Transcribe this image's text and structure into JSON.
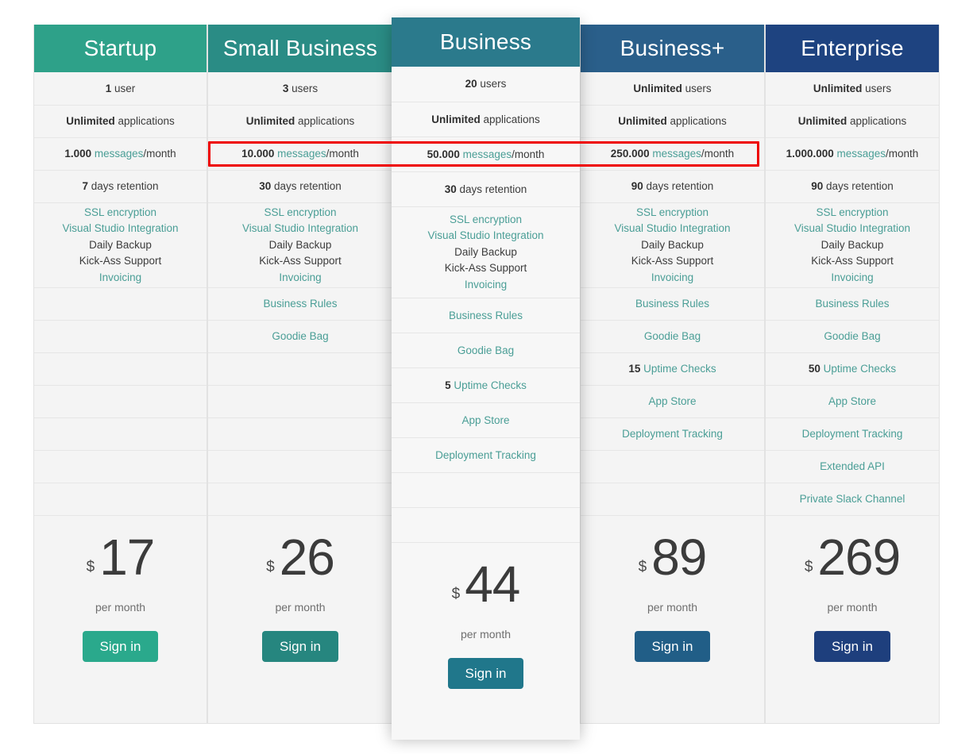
{
  "table": {
    "currency_symbol": "$",
    "per_month_label": "per month",
    "signin_label": "Sign in",
    "colors": {
      "startup_header": "#2ea189",
      "small_business_header": "#2a8c85",
      "business_header": "#2b7a8c",
      "business_plus_header": "#2a5f8a",
      "enterprise_header": "#1e4380",
      "startup_button": "#2aa98c",
      "small_business_button": "#26867f",
      "business_button": "#20778b",
      "business_plus_button": "#215e87",
      "enterprise_button": "#1e3f7d",
      "link_teal": "#4a9e96",
      "text_dark": "#3c3c3c",
      "cell_background": "#f4f4f4",
      "featured_background": "#f7f7f7",
      "highlight_red": "#ee0000"
    }
  },
  "plans": [
    {
      "id": "startup",
      "name": "Startup",
      "users_count": "1",
      "users_label": "user",
      "apps_count": "Unlimited",
      "apps_label": "applications",
      "messages_count": "1.000",
      "messages_word": "messages",
      "messages_suffix": "/month",
      "retention_count": "7",
      "retention_label": "days retention",
      "features": [
        {
          "text": "SSL encryption",
          "style": "teal"
        },
        {
          "text": "Visual Studio Integration",
          "style": "teal"
        },
        {
          "text": "Daily Backup",
          "style": "dark"
        },
        {
          "text": "Kick-Ass Support",
          "style": "dark"
        },
        {
          "text": "Invoicing",
          "style": "teal"
        }
      ],
      "business_rules": "",
      "goodie_bag": "",
      "uptime_count": "",
      "uptime_label": "",
      "app_store": "",
      "deployment_tracking": "",
      "extended_api": "",
      "private_slack": "",
      "price": "17"
    },
    {
      "id": "small-business",
      "name": "Small Business",
      "users_count": "3",
      "users_label": "users",
      "apps_count": "Unlimited",
      "apps_label": "applications",
      "messages_count": "10.000",
      "messages_word": "messages",
      "messages_suffix": "/month",
      "retention_count": "30",
      "retention_label": "days retention",
      "features": [
        {
          "text": "SSL encryption",
          "style": "teal"
        },
        {
          "text": "Visual Studio Integration",
          "style": "teal"
        },
        {
          "text": "Daily Backup",
          "style": "dark"
        },
        {
          "text": "Kick-Ass Support",
          "style": "dark"
        },
        {
          "text": "Invoicing",
          "style": "teal"
        }
      ],
      "business_rules": "Business Rules",
      "goodie_bag": "Goodie Bag",
      "uptime_count": "",
      "uptime_label": "",
      "app_store": "",
      "deployment_tracking": "",
      "extended_api": "",
      "private_slack": "",
      "price": "26"
    },
    {
      "id": "business",
      "name": "Business",
      "users_count": "20",
      "users_label": "users",
      "apps_count": "Unlimited",
      "apps_label": "applications",
      "messages_count": "50.000",
      "messages_word": "messages",
      "messages_suffix": "/month",
      "retention_count": "30",
      "retention_label": "days retention",
      "features": [
        {
          "text": "SSL encryption",
          "style": "teal"
        },
        {
          "text": "Visual Studio Integration",
          "style": "teal"
        },
        {
          "text": "Daily Backup",
          "style": "dark"
        },
        {
          "text": "Kick-Ass Support",
          "style": "dark"
        },
        {
          "text": "Invoicing",
          "style": "teal"
        }
      ],
      "business_rules": "Business Rules",
      "goodie_bag": "Goodie Bag",
      "uptime_count": "5",
      "uptime_label": "Uptime Checks",
      "app_store": "App Store",
      "deployment_tracking": "Deployment Tracking",
      "extended_api": "",
      "private_slack": "",
      "price": "44"
    },
    {
      "id": "business-plus",
      "name": "Business+",
      "users_count": "Unlimited",
      "users_label": "users",
      "apps_count": "Unlimited",
      "apps_label": "applications",
      "messages_count": "250.000",
      "messages_word": "messages",
      "messages_suffix": "/month",
      "retention_count": "90",
      "retention_label": "days retention",
      "features": [
        {
          "text": "SSL encryption",
          "style": "teal"
        },
        {
          "text": "Visual Studio Integration",
          "style": "teal"
        },
        {
          "text": "Daily Backup",
          "style": "dark"
        },
        {
          "text": "Kick-Ass Support",
          "style": "dark"
        },
        {
          "text": "Invoicing",
          "style": "teal"
        }
      ],
      "business_rules": "Business Rules",
      "goodie_bag": "Goodie Bag",
      "uptime_count": "15",
      "uptime_label": "Uptime Checks",
      "app_store": "App Store",
      "deployment_tracking": "Deployment Tracking",
      "extended_api": "",
      "private_slack": "",
      "price": "89"
    },
    {
      "id": "enterprise",
      "name": "Enterprise",
      "users_count": "Unlimited",
      "users_label": "users",
      "apps_count": "Unlimited",
      "apps_label": "applications",
      "messages_count": "1.000.000",
      "messages_word": "messages",
      "messages_suffix": "/month",
      "retention_count": "90",
      "retention_label": "days retention",
      "features": [
        {
          "text": "SSL encryption",
          "style": "teal"
        },
        {
          "text": "Visual Studio Integration",
          "style": "teal"
        },
        {
          "text": "Daily Backup",
          "style": "dark"
        },
        {
          "text": "Kick-Ass Support",
          "style": "dark"
        },
        {
          "text": "Invoicing",
          "style": "teal"
        }
      ],
      "business_rules": "Business Rules",
      "goodie_bag": "Goodie Bag",
      "uptime_count": "50",
      "uptime_label": "Uptime Checks",
      "app_store": "App Store",
      "deployment_tracking": "Deployment Tracking",
      "extended_api": "Extended API",
      "private_slack": "Private Slack Channel",
      "price": "269"
    }
  ],
  "annotation": {
    "type": "red-rectangle-highlight",
    "target_row": "messages/month",
    "spans_plans": [
      "Small Business",
      "Business",
      "Business+"
    ]
  }
}
